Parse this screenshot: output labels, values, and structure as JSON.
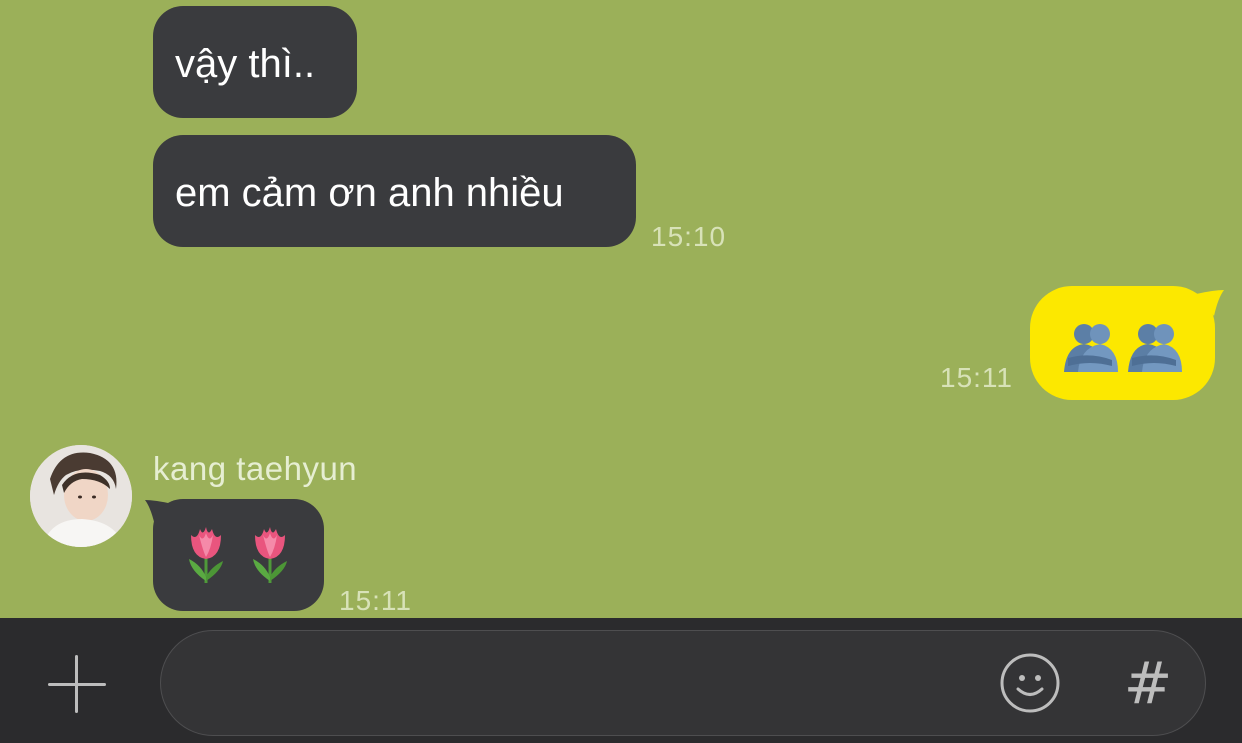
{
  "messages": [
    {
      "text": "vậy thì..",
      "side": "received"
    },
    {
      "text": "em cảm ơn anh nhiều",
      "side": "received",
      "time": "15:10"
    },
    {
      "emoji": [
        "people-hugging",
        "people-hugging"
      ],
      "side": "sent",
      "time": "15:11"
    },
    {
      "sender": "kang taehyun",
      "emoji": [
        "tulip",
        "tulip"
      ],
      "side": "received",
      "time": "15:11"
    }
  ],
  "composer": {
    "placeholder": "",
    "value": "",
    "hash_label": "#"
  },
  "colors": {
    "chat_background": "#9bb059",
    "received_bubble": "#3a3b3e",
    "sent_bubble": "#fce800",
    "composer_background": "#2b2b2d"
  }
}
